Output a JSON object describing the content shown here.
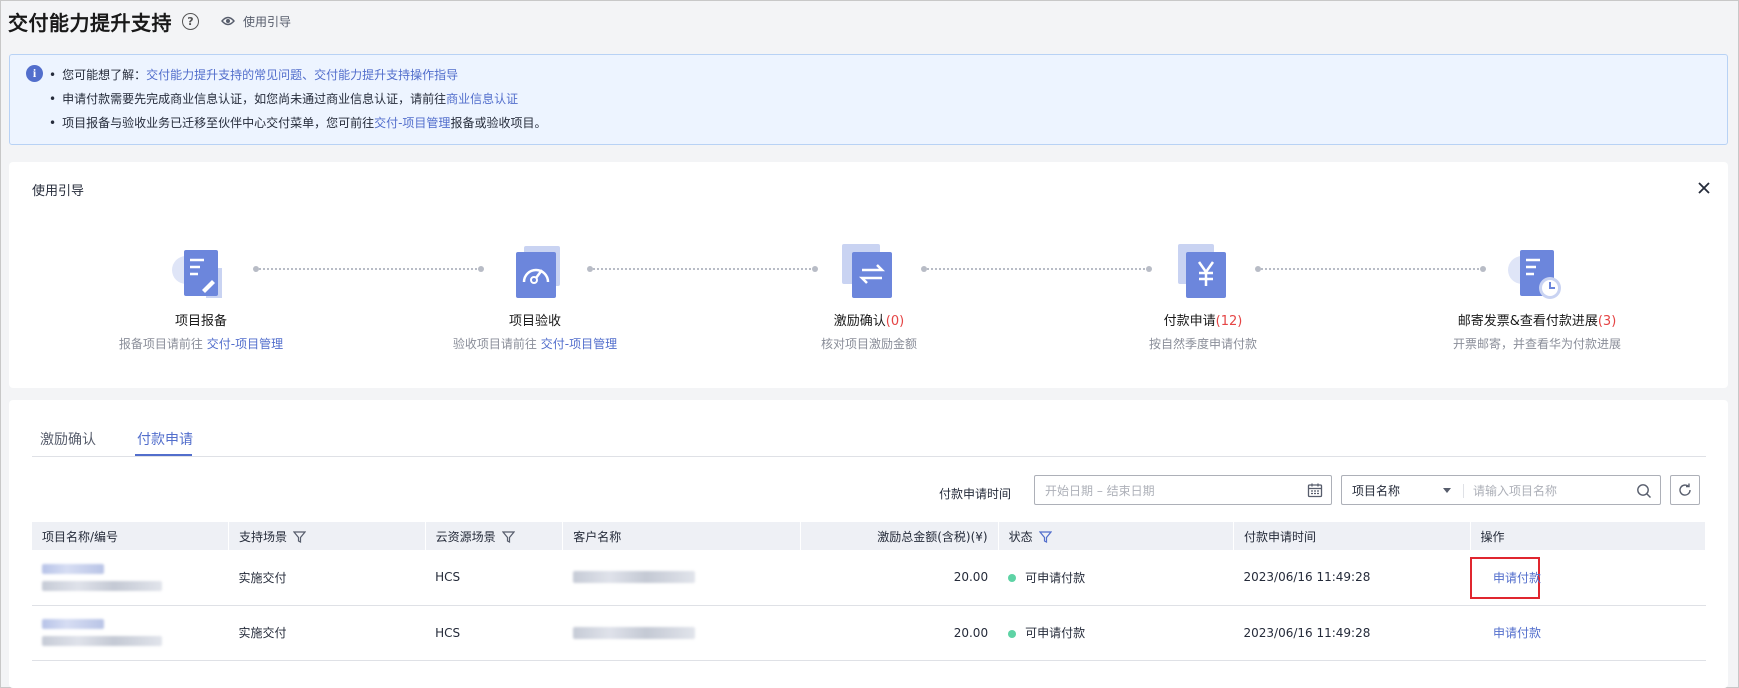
{
  "header": {
    "title": "交付能力提升支持",
    "help_icon": "?",
    "guide_link": "使用引导"
  },
  "banner": {
    "line1_prefix": "您可能想了解：",
    "line1_link1": "交付能力提升支持的常见问题",
    "line1_sep": "、",
    "line1_link2": "交付能力提升支持操作指导",
    "line2_text": "申请付款需要先完成商业信息认证，如您尚未通过商业信息认证，请前往",
    "line2_link": "商业信息认证",
    "line3_text_a": "项目报备与验收业务已迁移至伙伴中心交付菜单，您可前往",
    "line3_link": "交付-项目管理",
    "line3_text_b": "报备或验收项目。"
  },
  "guide": {
    "title": "使用引导",
    "steps": [
      {
        "name": "项目报备",
        "count": "",
        "desc": "报备项目请前往 ",
        "desc_link": "交付-项目管理"
      },
      {
        "name": "项目验收",
        "count": "",
        "desc": "验收项目请前往 ",
        "desc_link": "交付-项目管理"
      },
      {
        "name": "激励确认",
        "count": "(0)",
        "desc": "核对项目激励金额",
        "desc_link": ""
      },
      {
        "name": "付款申请",
        "count": "(12)",
        "desc": "按自然季度申请付款",
        "desc_link": ""
      },
      {
        "name": "邮寄发票&查看付款进展",
        "count": "(3)",
        "desc": "开票邮寄，并查看华为付款进展",
        "desc_link": ""
      }
    ]
  },
  "tabs": [
    {
      "label": "激励确认",
      "active": false
    },
    {
      "label": "付款申请",
      "active": true
    }
  ],
  "filters": {
    "time_label": "付款申请时间",
    "date_placeholder": "开始日期 – 结束日期",
    "select_value": "项目名称",
    "search_placeholder": "请输入项目名称"
  },
  "table": {
    "columns": [
      "项目名称/编号",
      "支持场景",
      "云资源场景",
      "客户名称",
      "激励总金额(含税)(¥)",
      "状态",
      "付款申请时间",
      "操作"
    ],
    "rows": [
      {
        "scene": "实施交付",
        "cloud": "HCS",
        "amount": "20.00",
        "status": "可申请付款",
        "time": "2023/06/16 11:49:28",
        "action": "申请付款",
        "highlighted": true
      },
      {
        "scene": "实施交付",
        "cloud": "HCS",
        "amount": "20.00",
        "status": "可申请付款",
        "time": "2023/06/16 11:49:28",
        "action": "申请付款",
        "highlighted": false
      }
    ]
  },
  "colors": {
    "accent": "#526ecc",
    "count_red": "#e54545",
    "status_green": "#5ed3a5",
    "highlight_red": "#e0262f"
  }
}
